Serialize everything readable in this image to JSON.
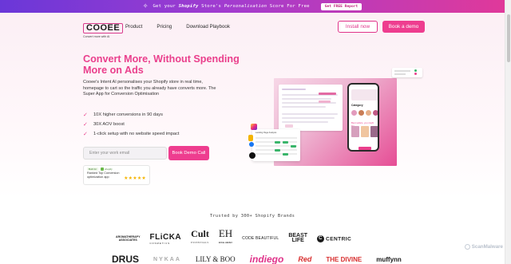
{
  "banner": {
    "text_prefix": "Get your ",
    "text_brand": "Shopify",
    "text_mid": " Store's ",
    "text_personalisation": "Personalisation",
    "text_suffix": " Score For Free",
    "button_label": "Get FREE Report"
  },
  "header": {
    "logo_name": "COOEE",
    "logo_tagline": "Convert more with AI",
    "nav_items": [
      "Product",
      "Pricing",
      "Download Playbook"
    ],
    "install_label": "Install now",
    "demo_label": "Book a demo"
  },
  "hero": {
    "headline": "Convert More, Without Spending More on Ads",
    "description": "Cooee's Intent AI personalises your Shopify store in real time, homepage to cart so the traffic you already have converts more. The Super App for Conversion Optimisation",
    "features": [
      "10X higher conversions in 90 days",
      "30X AOV boost",
      "1-click setup with no website speed impact"
    ],
    "email_placeholder": "Enter your work email",
    "cta_label": "Book Demo Call",
    "badge_tag": "Built for",
    "badge_platform": "shopify",
    "badge_text": "Ranked Top Conversion optimization app"
  },
  "mockup": {
    "phone_category": "Category",
    "phone_caption": "Best sellers, you might like",
    "table_title": "Landing Page Analysis"
  },
  "trusted": {
    "label": "Trusted by 300+ Shopify Brands",
    "row1": {
      "aroma_line1": "AROMATHERAPY",
      "aroma_line2": "ASSOCIATES",
      "flicka": "FLiCKA",
      "flicka_sub": "COSMETICS",
      "cult": "Cult",
      "cult_sub": "ESSENTIALS",
      "eh": "EH",
      "eh_sub": "EDGE HEMEX",
      "code": "CODE BEAUTIFUL",
      "beast_1": "BEAST",
      "beast_2": "LIFE",
      "centric": "CENTRIC"
    },
    "row2": [
      "DRUS",
      "NYKAA",
      "LILY & BOO",
      "indiego",
      "Red",
      "THE DIVINE",
      "muffynn"
    ]
  },
  "watermark": "ScanMalware",
  "colors": {
    "accent": "#ee3d8f",
    "headline": "#ea3f8c",
    "banner_start": "#6a37d8",
    "banner_end": "#e0399a"
  }
}
